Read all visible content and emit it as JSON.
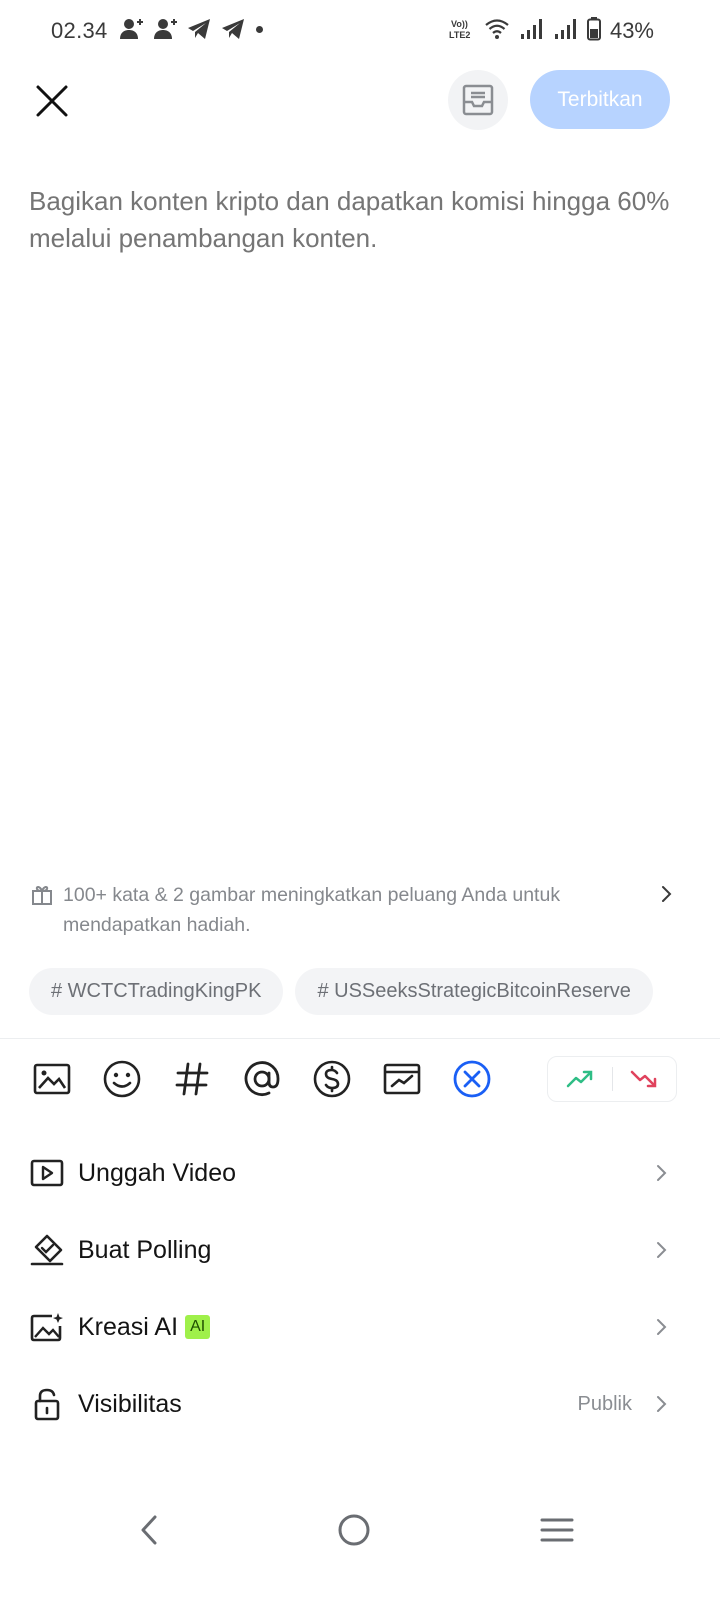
{
  "status_bar": {
    "time": "02.34",
    "battery": "43%",
    "left_icons": [
      "person-add-icon",
      "person-add-icon",
      "telegram-icon",
      "telegram-icon",
      "dot-icon"
    ],
    "right_icons": [
      "volte-lte2-icon",
      "wifi-icon",
      "signal-icon",
      "signal-icon",
      "battery-icon"
    ]
  },
  "header": {
    "publish_label": "Terbitkan",
    "publish_color": "#b7d3ff"
  },
  "editor": {
    "placeholder": "Bagikan konten kripto dan dapatkan komisi hingga 60% melalui penambangan konten."
  },
  "tip": {
    "text": "100+ kata & 2 gambar meningkatkan peluang Anda untuk mendapatkan hadiah."
  },
  "hashtags": [
    "# WCTCTradingKingPK",
    "# USSeeksStrategicBitcoinReserve"
  ],
  "toolbar": {
    "icons": [
      "image-icon",
      "emoji-icon",
      "hashtag-icon",
      "mention-icon",
      "dollar-icon",
      "chart-card-icon",
      "clear-circle-icon"
    ],
    "sentiment": [
      "bullish-icon",
      "bearish-icon"
    ],
    "bullish_color": "#2ebd85",
    "bearish_color": "#e0425d",
    "accent_color": "#1a5ff5"
  },
  "menu": {
    "upload_video": "Unggah Video",
    "create_poll": "Buat Polling",
    "ai_create": "Kreasi AI",
    "ai_badge": "AI",
    "visibility": "Visibilitas",
    "visibility_value": "Publik"
  },
  "nav": [
    "back-icon",
    "home-icon",
    "recents-icon"
  ]
}
